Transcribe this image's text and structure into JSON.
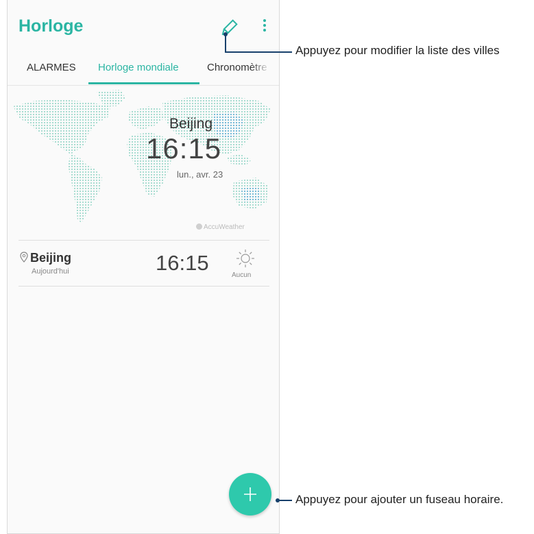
{
  "header": {
    "title": "Horloge"
  },
  "tabs": [
    {
      "label": "ALARMES"
    },
    {
      "label": "Horloge mondiale"
    },
    {
      "label": "Chronomètre"
    }
  ],
  "map_panel": {
    "city": "Beijing",
    "time": "16:15",
    "date": "lun., avr. 23",
    "provider": "AccuWeather"
  },
  "cities": [
    {
      "name": "Beijing",
      "day": "Aujourd'hui",
      "time": "16:15",
      "weather": "Aucun"
    }
  ],
  "callouts": {
    "edit": "Appuyez pour modifier la liste des villes",
    "add": "Appuyez pour ajouter un fuseau horaire."
  },
  "colors": {
    "accent": "#2bb5a3",
    "fab": "#2ec9ac",
    "callout_line": "#17406b"
  }
}
